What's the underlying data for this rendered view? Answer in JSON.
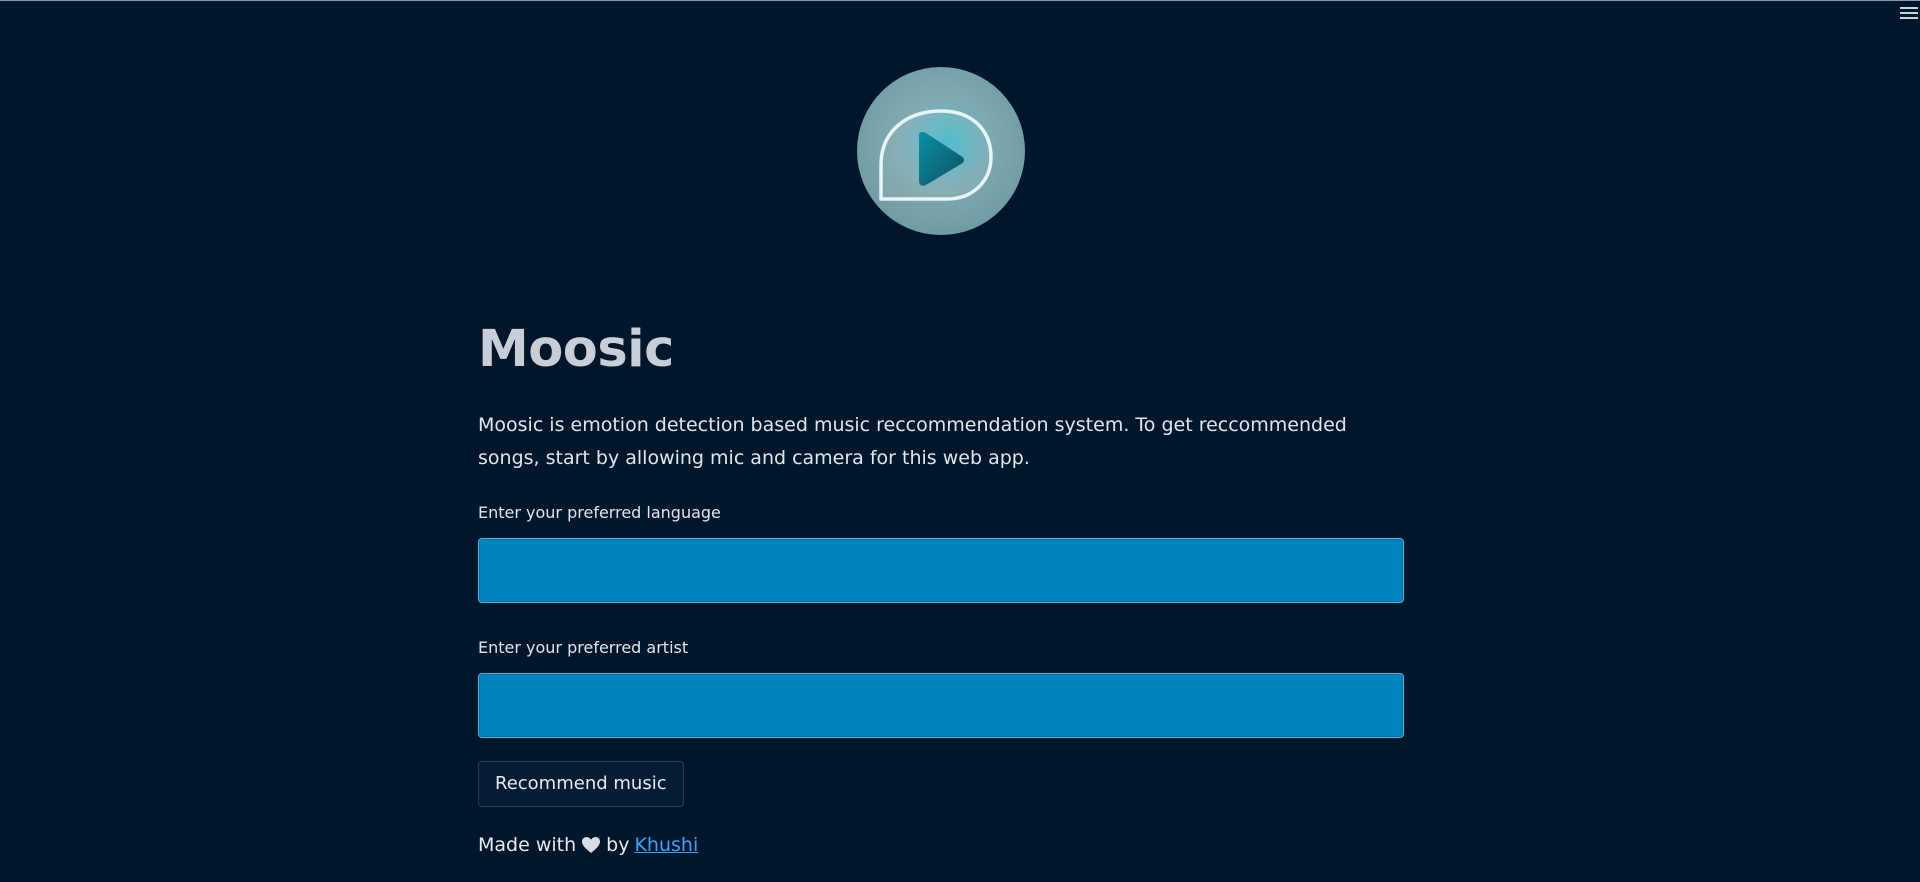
{
  "app": {
    "title": "Moosic",
    "description": "Moosic is emotion detection based music reccommendation system. To get reccommended songs, start by allowing mic and camera for this web app."
  },
  "header": {
    "menu_icon": "hamburger-menu-icon"
  },
  "logo": {
    "icon": "play-chat-bubble-icon"
  },
  "form": {
    "language_label": "Enter your preferred language",
    "language_value": "",
    "artist_label": "Enter your preferred artist",
    "artist_value": "",
    "submit_label": "Recommend music"
  },
  "footer": {
    "prefix": "Made with",
    "heart_icon": "heart-icon",
    "by": "by",
    "author_link": "Khushi"
  },
  "colors": {
    "background": "#00172b",
    "input_fill": "#0084bd",
    "link": "#3aa2ff"
  }
}
